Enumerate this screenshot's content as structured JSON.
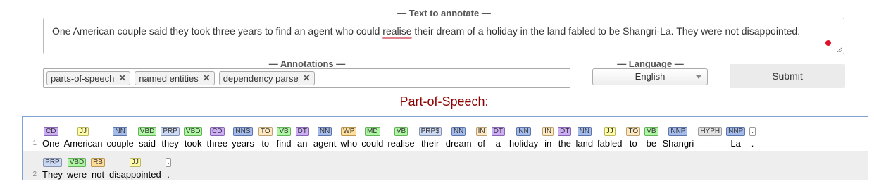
{
  "text_section": {
    "legend": "— Text to annotate —",
    "before": "One American couple said they took three years to find an agent who could ",
    "misspelled": "realise",
    "after": " their dream of a holiday in the land fabled to be Shangri-La. They were not disappointed."
  },
  "annotations": {
    "legend": "— Annotations —",
    "chips": [
      "parts-of-speech",
      "named entities",
      "dependency parse"
    ],
    "remove_glyph": "✕"
  },
  "language": {
    "legend": "— Language —",
    "selected": "English"
  },
  "submit_label": "Submit",
  "pos_title": "Part-of-Speech:",
  "colors": {
    "CD": "#ccadf6",
    "JJ": "#fffda8",
    "NN": "#a4bced",
    "VB": "#adf6a2",
    "PRP": "#ccdaf6",
    "TO": "#ffe8be",
    "DT": "#ccadf6",
    "WP": "#ffde9c",
    "MD": "#adf6a2",
    "IN": "#ffe8be",
    "RB": "#ffde9c",
    "NNP": "#a4bced",
    "HYPH": "#e3e3e3",
    "PUNCT": "#ffffff"
  },
  "sentences": [
    {
      "line": "1",
      "tokens": [
        {
          "w": "One",
          "t": "CD",
          "c": "CD"
        },
        {
          "w": "American",
          "t": "JJ",
          "c": "JJ"
        },
        {
          "w": "couple",
          "t": "NN",
          "c": "NN"
        },
        {
          "w": "said",
          "t": "VBD",
          "c": "VB"
        },
        {
          "w": "they",
          "t": "PRP",
          "c": "PRP"
        },
        {
          "w": "took",
          "t": "VBD",
          "c": "VB"
        },
        {
          "w": "three",
          "t": "CD",
          "c": "CD"
        },
        {
          "w": "years",
          "t": "NNS",
          "c": "NN"
        },
        {
          "w": "to",
          "t": "TO",
          "c": "TO"
        },
        {
          "w": "find",
          "t": "VB",
          "c": "VB"
        },
        {
          "w": "an",
          "t": "DT",
          "c": "DT"
        },
        {
          "w": "agent",
          "t": "NN",
          "c": "NN"
        },
        {
          "w": "who",
          "t": "WP",
          "c": "WP"
        },
        {
          "w": "could",
          "t": "MD",
          "c": "MD"
        },
        {
          "w": "realise",
          "t": "VB",
          "c": "VB"
        },
        {
          "w": "their",
          "t": "PRP$",
          "c": "PRP"
        },
        {
          "w": "dream",
          "t": "NN",
          "c": "NN"
        },
        {
          "w": "of",
          "t": "IN",
          "c": "IN"
        },
        {
          "w": "a",
          "t": "DT",
          "c": "DT"
        },
        {
          "w": "holiday",
          "t": "NN",
          "c": "NN"
        },
        {
          "w": "in",
          "t": "IN",
          "c": "IN"
        },
        {
          "w": "the",
          "t": "DT",
          "c": "DT"
        },
        {
          "w": "land",
          "t": "NN",
          "c": "NN"
        },
        {
          "w": "fabled",
          "t": "JJ",
          "c": "JJ"
        },
        {
          "w": "to",
          "t": "TO",
          "c": "TO"
        },
        {
          "w": "be",
          "t": "VB",
          "c": "VB"
        },
        {
          "w": "Shangri",
          "t": "NNP",
          "c": "NNP"
        },
        {
          "w": "-",
          "t": "HYPH",
          "c": "HYPH"
        },
        {
          "w": "La",
          "t": "NNP",
          "c": "NNP"
        },
        {
          "w": ".",
          "t": ".",
          "c": "PUNCT"
        }
      ]
    },
    {
      "line": "2",
      "tokens": [
        {
          "w": "They",
          "t": "PRP",
          "c": "PRP"
        },
        {
          "w": "were",
          "t": "VBD",
          "c": "VB"
        },
        {
          "w": "not",
          "t": "RB",
          "c": "RB"
        },
        {
          "w": "disappointed",
          "t": "JJ",
          "c": "JJ"
        },
        {
          "w": ".",
          "t": ".",
          "c": "PUNCT"
        }
      ]
    }
  ]
}
